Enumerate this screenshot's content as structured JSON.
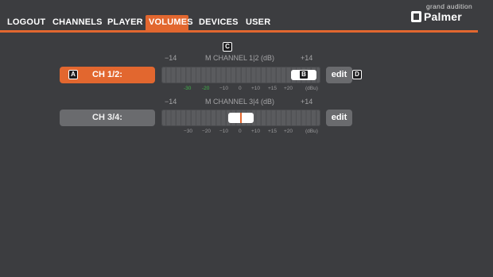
{
  "nav": {
    "items": [
      {
        "label": "LOGOUT"
      },
      {
        "label": "CHANNELS"
      },
      {
        "label": "PLAYER"
      },
      {
        "label": "VOLUMES",
        "active": true
      },
      {
        "label": "DEVICES"
      },
      {
        "label": "USER"
      }
    ]
  },
  "brand": {
    "tagline": "grand audition",
    "name": "Palmer"
  },
  "markers": {
    "a": "A",
    "b": "B",
    "c": "C",
    "d": "D"
  },
  "channels": [
    {
      "button_label": "CH 1/2:",
      "active": true,
      "meter_title": "M CHANNEL 1|2 (dB)",
      "range_min": "−14",
      "range_max": "+14",
      "scale": [
        "-30",
        "-20",
        "−10",
        "0",
        "+10",
        "+15",
        "+20",
        "(dBu)"
      ],
      "edit_label": "edit"
    },
    {
      "button_label": "CH 3/4:",
      "active": false,
      "meter_title": "M CHANNEL 3|4 (dB)",
      "range_min": "−14",
      "range_max": "+14",
      "scale": [
        "−30",
        "−20",
        "−10",
        "0",
        "+10",
        "+15",
        "+20",
        "(dBu)"
      ],
      "edit_label": "edit"
    }
  ],
  "colors": {
    "accent": "#e2672f",
    "background": "#3c3d40",
    "button_inactive": "#6a6b6e",
    "scale_green": "#3fb84a"
  }
}
